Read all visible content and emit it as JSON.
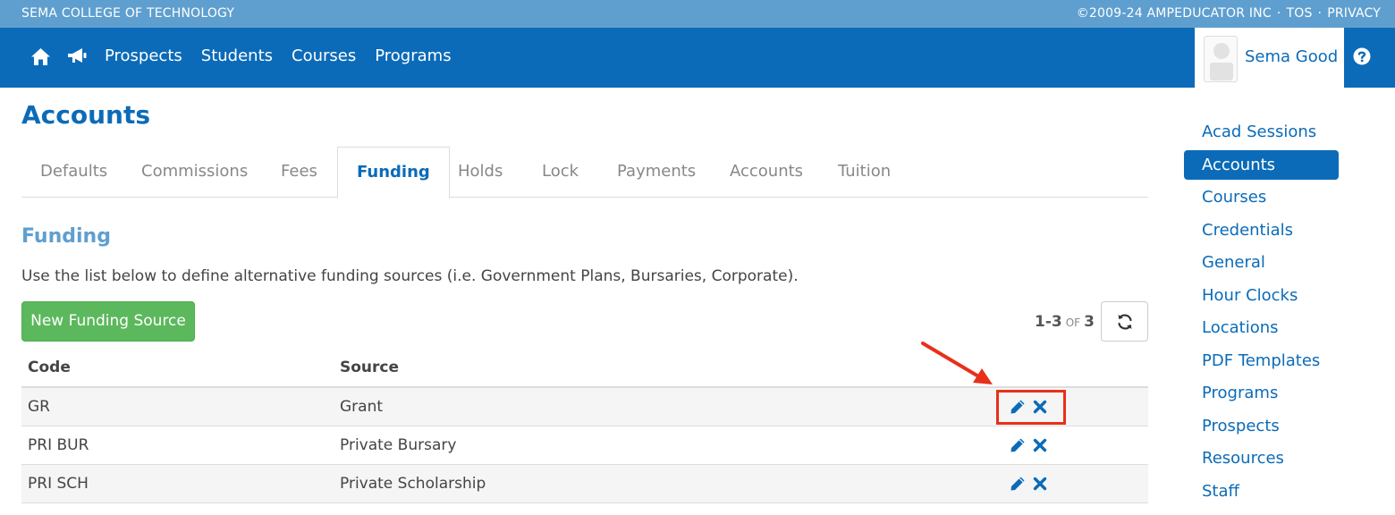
{
  "topbar": {
    "org": "SEMA COLLEGE OF TECHNOLOGY",
    "copyright": "©2009-24 AMPEDUCATOR INC",
    "tos": "TOS",
    "privacy": "PRIVACY",
    "separator": "·"
  },
  "nav": {
    "links": [
      "Prospects",
      "Students",
      "Courses",
      "Programs"
    ],
    "user_name": "Sema Good",
    "icons": [
      "home-icon",
      "megaphone-icon",
      "avatar",
      "help-icon"
    ]
  },
  "page": {
    "title": "Accounts"
  },
  "tabs": [
    {
      "label": "Defaults",
      "active": false
    },
    {
      "label": "Commissions",
      "active": false
    },
    {
      "label": "Fees",
      "active": false
    },
    {
      "label": "Funding",
      "active": true
    },
    {
      "label": "Holds",
      "active": false
    },
    {
      "label": "Lock",
      "active": false
    },
    {
      "label": "Payments",
      "active": false
    },
    {
      "label": "Accounts",
      "active": false
    },
    {
      "label": "Tuition",
      "active": false
    }
  ],
  "section": {
    "title": "Funding",
    "description": "Use the list below to define alternative funding sources (i.e. Government Plans, Bursaries, Corporate).",
    "new_button": "New Funding Source"
  },
  "paging": {
    "range": "1-3",
    "of": "OF",
    "total": "3"
  },
  "table": {
    "headers": [
      "Code",
      "Source"
    ],
    "rows": [
      {
        "code": "GR",
        "source": "Grant"
      },
      {
        "code": "PRI BUR",
        "source": "Private Bursary"
      },
      {
        "code": "PRI SCH",
        "source": "Private Scholarship"
      }
    ]
  },
  "sidebar": {
    "items": [
      {
        "label": "Acad Sessions",
        "active": false
      },
      {
        "label": "Accounts",
        "active": true
      },
      {
        "label": "Courses",
        "active": false
      },
      {
        "label": "Credentials",
        "active": false
      },
      {
        "label": "General",
        "active": false
      },
      {
        "label": "Hour Clocks",
        "active": false
      },
      {
        "label": "Locations",
        "active": false
      },
      {
        "label": "PDF Templates",
        "active": false
      },
      {
        "label": "Programs",
        "active": false
      },
      {
        "label": "Prospects",
        "active": false
      },
      {
        "label": "Resources",
        "active": false
      },
      {
        "label": "Staff",
        "active": false
      }
    ]
  },
  "colors": {
    "brand": "#0b6bb8",
    "topstrip": "#5f9fcf",
    "success": "#5cb85c",
    "annotation": "#e8301a"
  }
}
